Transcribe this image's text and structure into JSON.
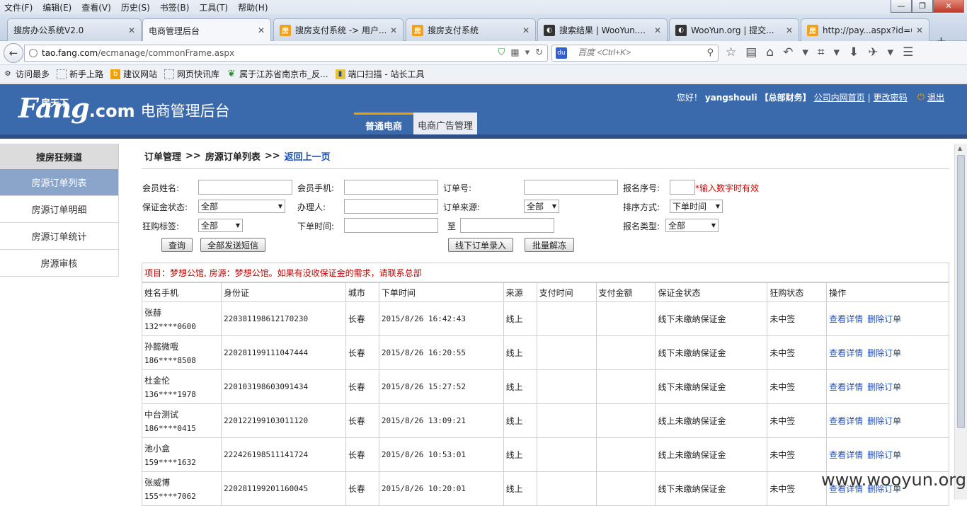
{
  "browser": {
    "menu": [
      "文件(F)",
      "编辑(E)",
      "查看(V)",
      "历史(S)",
      "书签(B)",
      "工具(T)",
      "帮助(H)"
    ],
    "window_buttons": [
      "—",
      "❐",
      "✕"
    ],
    "tabs": [
      {
        "title": "搜房办公系统V2.0",
        "icon": "none"
      },
      {
        "title": "电商管理后台",
        "icon": "none"
      },
      {
        "title": "搜房支付系统 -> 用户...",
        "icon": "fang"
      },
      {
        "title": "搜房支付系统",
        "icon": "fang"
      },
      {
        "title": "搜索结果 | WooYun....",
        "icon": "wooyun"
      },
      {
        "title": "WooYun.org | 提交...",
        "icon": "wooyun"
      },
      {
        "title": "http://pay...aspx?id=6",
        "icon": "fang"
      }
    ],
    "url_host": "tao.fang.com",
    "url_path": "/ecmanage/commonFrame.aspx",
    "search_placeholder": "百度 <Ctrl+K>",
    "bookmarks": [
      "访问最多",
      "新手上路",
      "建议网站",
      "网页快讯库",
      "属于江苏省南京市_反...",
      "端口扫描 - 站长工具"
    ]
  },
  "header": {
    "brand_cn": "房天下",
    "brand_fang": "Fang",
    "brand_com": ".com",
    "system_title": "电商管理后台",
    "greeting": "您好！",
    "username": "yangshouli",
    "role": "【总部财务】",
    "link_home": "公司内网首页",
    "separator": "|",
    "link_password": "更改密码",
    "logout": "退出",
    "nav": [
      "普通电商",
      "电商广告管理"
    ]
  },
  "sidebar": {
    "heading": "搜房狂频道",
    "items": [
      "房源订单列表",
      "房源订单明细",
      "房源订单统计",
      "房源审核"
    ]
  },
  "breadcrumb": {
    "part1": "订单管理",
    "sep": ">>",
    "part2": "房源订单列表",
    "back_link": "返回上一页"
  },
  "filters": {
    "member_name_label": "会员姓名:",
    "member_phone_label": "会员手机:",
    "order_no_label": "订单号:",
    "signup_no_label": "报名序号:",
    "signup_hint": "*输入数字时有效",
    "deposit_status_label": "保证金状态:",
    "deposit_status_value": "全部",
    "handler_label": "办理人:",
    "order_source_label": "订单来源:",
    "order_source_value": "全部",
    "sort_label": "排序方式:",
    "sort_value": "下单时间",
    "rush_tag_label": "狂购标签:",
    "rush_tag_value": "全部",
    "order_time_label": "下单时间:",
    "to_label": "至",
    "signup_type_label": "报名类型:",
    "signup_type_value": "全部",
    "btn_query": "查询",
    "btn_sms": "全部发送短信",
    "btn_offline": "线下订单录入",
    "btn_batch": "批量解冻"
  },
  "notice": "项目：梦想公馆, 房源：梦想公馆。如果有没收保证金的需求，请联系总部",
  "table": {
    "headers": [
      "姓名手机",
      "身份证",
      "城市",
      "下单时间",
      "来源",
      "支付时间",
      "支付金额",
      "保证金状态",
      "狂购状态",
      "操作"
    ],
    "view_label": "查看详情",
    "delete_label": "删除订单",
    "rows": [
      {
        "name": "张赫",
        "phone": "132****0600",
        "id": "220381198612170230",
        "city": "长春",
        "time": "2015/8/26 16:42:43",
        "source": "线上",
        "paytime": "",
        "amount": "",
        "deposit": "线下未缴纳保证金",
        "rush": "未中签"
      },
      {
        "name": "孙懿微哦",
        "phone": "186****8508",
        "id": "220281199111047444",
        "city": "长春",
        "time": "2015/8/26 16:20:55",
        "source": "线上",
        "paytime": "",
        "amount": "",
        "deposit": "线下未缴纳保证金",
        "rush": "未中签"
      },
      {
        "name": "杜金伦",
        "phone": "136****1978",
        "id": "220103198603091434",
        "city": "长春",
        "time": "2015/8/26 15:27:52",
        "source": "线上",
        "paytime": "",
        "amount": "",
        "deposit": "线下未缴纳保证金",
        "rush": "未中签"
      },
      {
        "name": "中台测试",
        "phone": "186****0415",
        "id": "220122199103011120",
        "city": "长春",
        "time": "2015/8/26 13:09:21",
        "source": "线上",
        "paytime": "",
        "amount": "",
        "deposit": "线上未缴纳保证金",
        "rush": "未中签"
      },
      {
        "name": "池小盒",
        "phone": "159****1632",
        "id": "222426198511141724",
        "city": "长春",
        "time": "2015/8/26 10:53:01",
        "source": "线上",
        "paytime": "",
        "amount": "",
        "deposit": "线上未缴纳保证金",
        "rush": "未中签"
      },
      {
        "name": "张威博",
        "phone": "155****7062",
        "id": "220281199201160045",
        "city": "长春",
        "time": "2015/8/26 10:20:01",
        "source": "线上",
        "paytime": "",
        "amount": "",
        "deposit": "线下未缴纳保证金",
        "rush": "未中签"
      }
    ]
  },
  "watermark": "www.wooyun.org",
  "colors": {
    "header_blue": "#3b6aac",
    "accent_orange": "#f0a000",
    "link_blue": "#1f4fb5",
    "notice_red": "#c00000"
  }
}
